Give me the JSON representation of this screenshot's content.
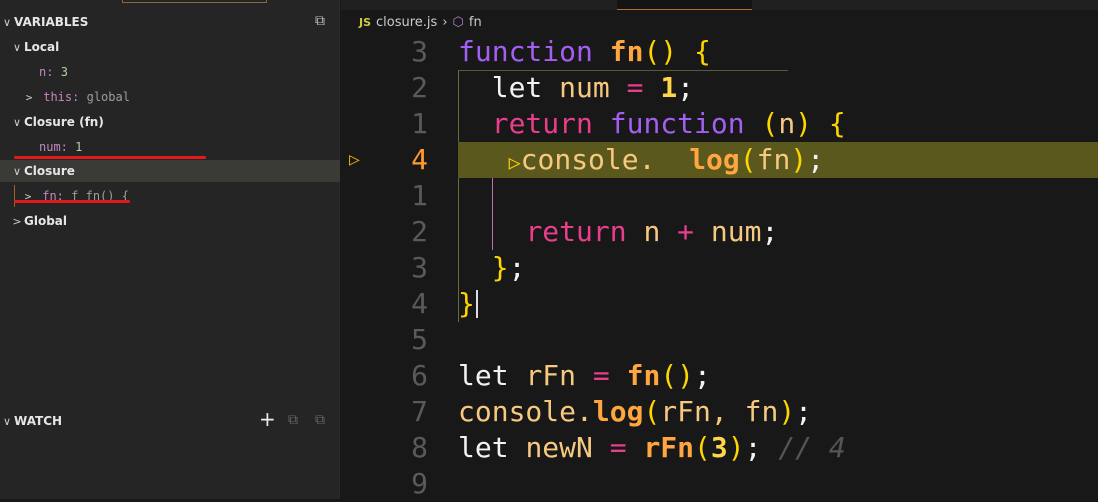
{
  "sidebar": {
    "variables_title": "VARIABLES",
    "scopes": {
      "local": {
        "label": "Local",
        "n_name": "n:",
        "n_value": "3",
        "this_name": "this:",
        "this_value": "global"
      },
      "closure_fn": {
        "label": "Closure (fn)",
        "num_name": "num:",
        "num_value": "1"
      },
      "closure": {
        "label": "Closure",
        "fn_name": "fn:",
        "fn_value": "f fn() {"
      },
      "global": {
        "label": "Global"
      }
    },
    "watch_title": "WATCH"
  },
  "breadcrumb": {
    "lang": "JS",
    "file": "closure.js",
    "symbol": "fn"
  },
  "colors": {
    "highlight": "#5a5a1c",
    "annotation": "#e01b1b"
  },
  "code": {
    "lines": [
      {
        "num": "3",
        "tokens": [
          [
            "kw",
            "function"
          ],
          [
            "pun",
            " "
          ],
          [
            "fn",
            "fn"
          ],
          [
            "br",
            "()"
          ],
          [
            "pun",
            " "
          ],
          [
            "br",
            "{"
          ]
        ]
      },
      {
        "num": "2",
        "tokens": [
          [
            "pun",
            "  "
          ],
          [
            "let",
            "let"
          ],
          [
            "pun",
            " "
          ],
          [
            "var",
            "num"
          ],
          [
            "pun",
            " "
          ],
          [
            "op",
            "="
          ],
          [
            "pun",
            " "
          ],
          [
            "num",
            "1"
          ],
          [
            "pun",
            ";"
          ]
        ]
      },
      {
        "num": "1",
        "tokens": [
          [
            "pun",
            "  "
          ],
          [
            "ret",
            "return"
          ],
          [
            "pun",
            " "
          ],
          [
            "kw",
            "function"
          ],
          [
            "pun",
            " "
          ],
          [
            "br",
            "("
          ],
          [
            "var",
            "n"
          ],
          [
            "br",
            ")"
          ],
          [
            "pun",
            " "
          ],
          [
            "br",
            "{"
          ]
        ]
      },
      {
        "num": "4",
        "current": true,
        "tokens": [
          [
            "pun",
            "   "
          ],
          [
            "br",
            "▷"
          ],
          [
            "obj",
            "console."
          ],
          [
            "pun",
            "  "
          ],
          [
            "fn",
            "log"
          ],
          [
            "br",
            "("
          ],
          [
            "var",
            "fn"
          ],
          [
            "br",
            ")"
          ],
          [
            "pun",
            ";"
          ]
        ]
      },
      {
        "num": "1",
        "tokens": []
      },
      {
        "num": "2",
        "tokens": [
          [
            "pun",
            "    "
          ],
          [
            "ret",
            "return"
          ],
          [
            "pun",
            " "
          ],
          [
            "var",
            "n"
          ],
          [
            "pun",
            " "
          ],
          [
            "op",
            "+"
          ],
          [
            "pun",
            " "
          ],
          [
            "var",
            "num"
          ],
          [
            "pun",
            ";"
          ]
        ]
      },
      {
        "num": "3",
        "tokens": [
          [
            "pun",
            "  "
          ],
          [
            "br",
            "}"
          ],
          [
            "pun",
            ";"
          ]
        ]
      },
      {
        "num": "4",
        "tokens": [
          [
            "br",
            "}"
          ]
        ]
      },
      {
        "num": "5",
        "tokens": []
      },
      {
        "num": "6",
        "tokens": [
          [
            "let",
            "let"
          ],
          [
            "pun",
            " "
          ],
          [
            "var",
            "rFn"
          ],
          [
            "pun",
            " "
          ],
          [
            "op",
            "="
          ],
          [
            "pun",
            " "
          ],
          [
            "fn",
            "fn"
          ],
          [
            "br",
            "()"
          ],
          [
            "pun",
            ";"
          ]
        ]
      },
      {
        "num": "7",
        "tokens": [
          [
            "obj",
            "console."
          ],
          [
            "fn",
            "log"
          ],
          [
            "br",
            "("
          ],
          [
            "var",
            "rFn, fn"
          ],
          [
            "br",
            ")"
          ],
          [
            "pun",
            ";"
          ]
        ]
      },
      {
        "num": "8",
        "tokens": [
          [
            "let",
            "let"
          ],
          [
            "pun",
            " "
          ],
          [
            "var",
            "newN"
          ],
          [
            "pun",
            " "
          ],
          [
            "op",
            "="
          ],
          [
            "pun",
            " "
          ],
          [
            "fn",
            "rFn"
          ],
          [
            "br",
            "("
          ],
          [
            "num",
            "3"
          ],
          [
            "br",
            ")"
          ],
          [
            "pun",
            "; "
          ],
          [
            "cm",
            "// 4"
          ]
        ]
      },
      {
        "num": "9",
        "tokens": []
      }
    ]
  }
}
